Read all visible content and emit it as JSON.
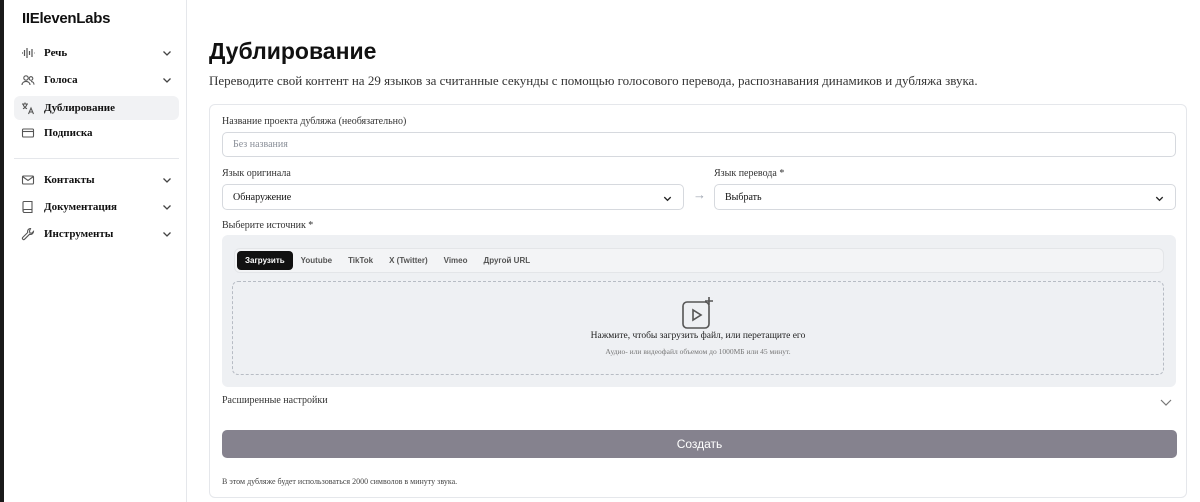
{
  "brand": {
    "logo": "IIElevenLabs"
  },
  "sidebar": {
    "items": [
      {
        "label": "Речь",
        "icon": "waveform-icon",
        "expandable": true
      },
      {
        "label": "Голоса",
        "icon": "users-icon",
        "expandable": true
      },
      {
        "label": "Дублирование",
        "icon": "translate-icon",
        "expandable": false,
        "active": true
      },
      {
        "label": "Подписка",
        "icon": "card-icon",
        "expandable": false
      }
    ],
    "bottom_items": [
      {
        "label": "Контакты",
        "icon": "mail-icon",
        "expandable": true
      },
      {
        "label": "Документация",
        "icon": "book-icon",
        "expandable": true
      },
      {
        "label": "Инструменты",
        "icon": "wrench-icon",
        "expandable": true
      }
    ]
  },
  "main": {
    "title": "Дублирование",
    "subtitle": "Переводите свой контент на 29 языков за считанные секунды с помощью голосового перевода, распознавания динамиков и дубляжа звука."
  },
  "form": {
    "project_name_label": "Название проекта дубляжа (необязательно)",
    "project_name_placeholder": "Без названия",
    "source_lang_label": "Язык оригинала",
    "source_lang_value": "Обнаружение",
    "target_lang_label": "Язык перевода *",
    "target_lang_value": "Выбрать",
    "source_label": "Выберите источник *",
    "tabs": [
      "Загрузить",
      "Youtube",
      "TikTok",
      "X (Twitter)",
      "Vimeo",
      "Другой URL"
    ],
    "active_tab": "Загрузить",
    "upload_main": "Нажмите, чтобы загрузить файл, или перетащите его",
    "upload_sub": "Аудио- или видеофайл объемом до 1000МБ или 45 минут.",
    "advanced_label": "Расширенные настройки",
    "create_button": "Создать",
    "note": "В этом дубляже будет использоваться 2000 символов в минуту звука."
  },
  "colors": {
    "create_button_bg": "#85828e",
    "active_tab_bg": "#111111",
    "source_panel_bg": "#eef0f3"
  }
}
